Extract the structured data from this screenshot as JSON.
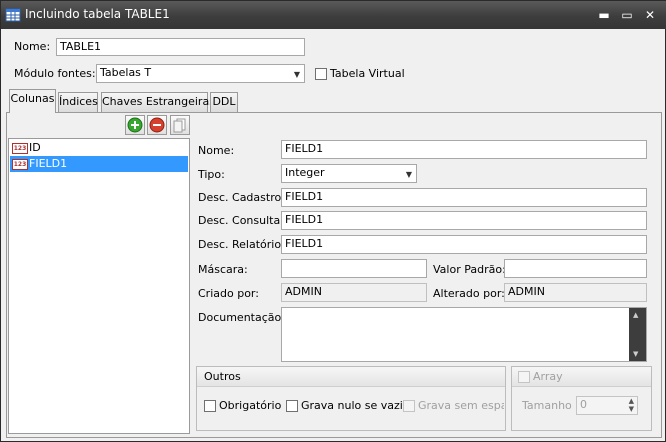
{
  "window": {
    "title": "Incluindo tabela TABLE1",
    "minimize": "▬",
    "maximize": "▭",
    "close": "✕"
  },
  "header": {
    "name_label": "Nome:",
    "name_value": "TABLE1",
    "module_label": "Módulo fontes:",
    "module_value": "Tabelas T",
    "virtual_label": "Tabela Virtual"
  },
  "tabs": [
    {
      "label": "Colunas"
    },
    {
      "label": "Índices"
    },
    {
      "label": "Chaves Estrangeiras"
    },
    {
      "label": "DDL"
    }
  ],
  "toolbar": {
    "add_icon": "plus-circle-icon",
    "remove_icon": "minus-circle-icon",
    "copy_icon": "copy-icon"
  },
  "columns_list": [
    {
      "icon_text": "123",
      "label": "ID",
      "selected": false
    },
    {
      "icon_text": "123",
      "label": "FIELD1",
      "selected": true
    }
  ],
  "form": {
    "name_label": "Nome:",
    "name_value": "FIELD1",
    "type_label": "Tipo:",
    "type_value": "Integer",
    "desc_cadastro_label": "Desc. Cadastro:",
    "desc_cadastro_value": "FIELD1",
    "desc_consulta_label": "Desc. Consulta:",
    "desc_consulta_value": "FIELD1",
    "desc_relatorio_label": "Desc. Relatório:",
    "desc_relatorio_value": "FIELD1",
    "mascara_label": "Máscara:",
    "mascara_value": "",
    "valor_padrao_label": "Valor Padrão:",
    "valor_padrao_value": "",
    "criado_por_label": "Criado por:",
    "criado_por_value": "ADMIN",
    "alterado_por_label": "Alterado por:",
    "alterado_por_value": "ADMIN",
    "documentacao_label": "Documentação:",
    "documentacao_value": ""
  },
  "outros": {
    "title": "Outros",
    "obrigatorio_label": "Obrigatório",
    "grava_nulo_label": "Grava nulo se vazio",
    "grava_sem_espacos_label": "Grava sem espaços"
  },
  "array": {
    "title": "Array",
    "tamanho_label": "Tamanho",
    "tamanho_value": "0"
  }
}
